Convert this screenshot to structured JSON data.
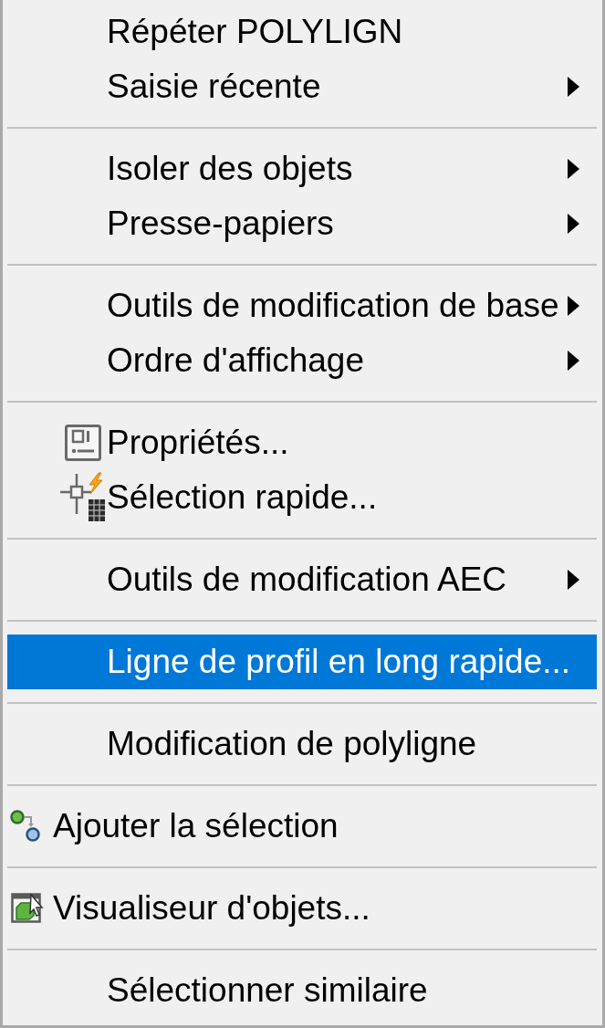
{
  "menu": {
    "groups": [
      {
        "items": [
          {
            "label": "Répéter POLYLIGN",
            "kind": "plain",
            "submenu": false,
            "selected": false
          },
          {
            "label": "Saisie récente",
            "kind": "plain",
            "submenu": true,
            "selected": false
          }
        ]
      },
      {
        "items": [
          {
            "label": "Isoler des objets",
            "kind": "plain",
            "submenu": true,
            "selected": false
          },
          {
            "label": "Presse-papiers",
            "kind": "plain",
            "submenu": true,
            "selected": false
          }
        ]
      },
      {
        "items": [
          {
            "label": "Outils de modification de base",
            "kind": "plain",
            "submenu": true,
            "selected": false
          },
          {
            "label": "Ordre d'affichage",
            "kind": "plain",
            "submenu": true,
            "selected": false
          }
        ]
      },
      {
        "items": [
          {
            "label": "Propriétés...",
            "kind": "properties",
            "submenu": false,
            "selected": false
          },
          {
            "label": "Sélection rapide...",
            "kind": "quickselect",
            "submenu": false,
            "selected": false
          }
        ]
      },
      {
        "items": [
          {
            "label": "Outils de modification AEC",
            "kind": "plain",
            "submenu": true,
            "selected": false
          }
        ]
      },
      {
        "items": [
          {
            "label": "Ligne de profil en long rapide...",
            "kind": "plain",
            "submenu": false,
            "selected": true
          }
        ]
      },
      {
        "items": [
          {
            "label": "Modification de polyligne",
            "kind": "plain",
            "submenu": false,
            "selected": false
          }
        ]
      },
      {
        "items": [
          {
            "label": "Ajouter la sélection",
            "kind": "addselection",
            "submenu": false,
            "selected": false
          }
        ]
      },
      {
        "items": [
          {
            "label": "Visualiseur d'objets...",
            "kind": "viewer",
            "submenu": false,
            "selected": false
          }
        ]
      },
      {
        "items": [
          {
            "label": "Sélectionner similaire",
            "kind": "plain",
            "submenu": false,
            "selected": false
          }
        ]
      }
    ]
  }
}
